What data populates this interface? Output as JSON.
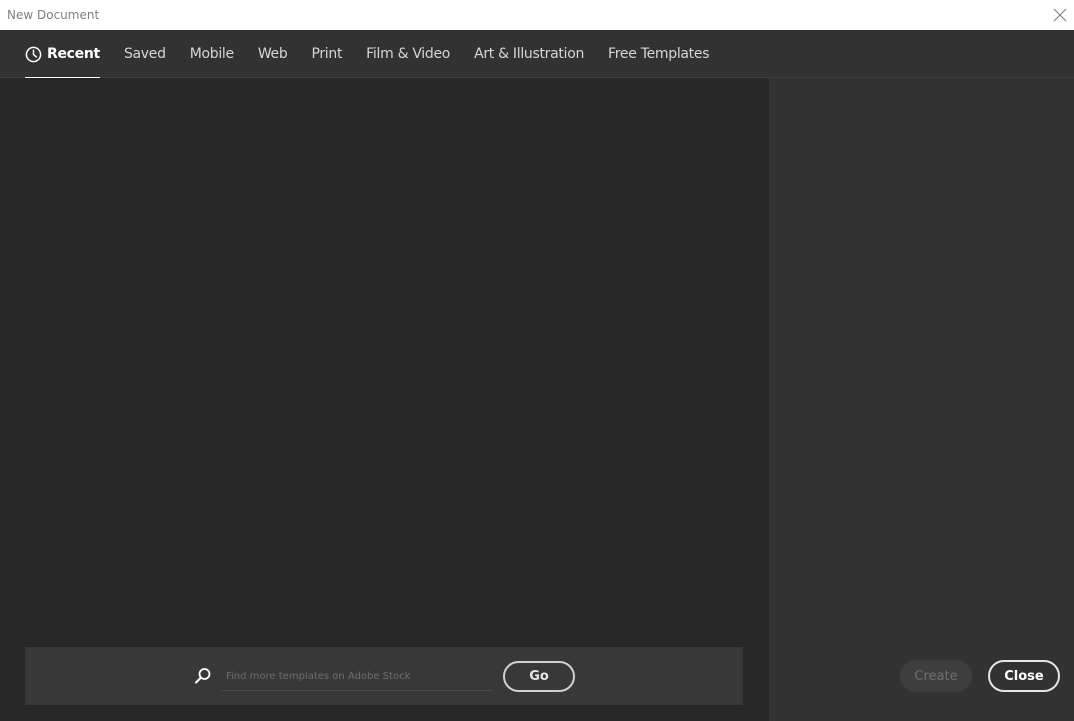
{
  "window": {
    "title": "New Document"
  },
  "tabs": [
    {
      "label": "Recent",
      "active": true
    },
    {
      "label": "Saved",
      "active": false
    },
    {
      "label": "Mobile",
      "active": false
    },
    {
      "label": "Web",
      "active": false
    },
    {
      "label": "Print",
      "active": false
    },
    {
      "label": "Film & Video",
      "active": false
    },
    {
      "label": "Art & Illustration",
      "active": false
    },
    {
      "label": "Free Templates",
      "active": false
    }
  ],
  "search": {
    "placeholder": "Find more templates on Adobe Stock",
    "value": "",
    "go_label": "Go"
  },
  "actions": {
    "create_label": "Create",
    "close_label": "Close"
  },
  "icons": {
    "window_close": "close-icon",
    "recent": "clock-icon",
    "search": "search-icon"
  },
  "colors": {
    "titlebar": "#ffffff",
    "tabbar": "#323232",
    "main": "#272727",
    "panel": "#323232",
    "accent": "#ffffff"
  }
}
